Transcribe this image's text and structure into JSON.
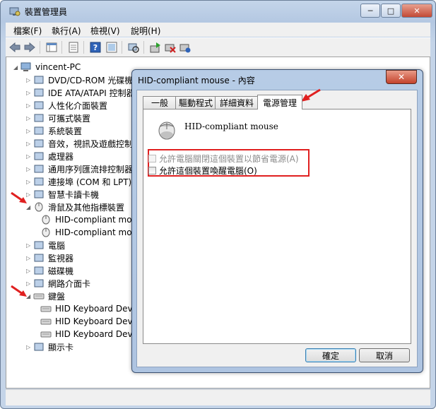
{
  "window": {
    "title": "裝置管理員",
    "controls": [
      "─",
      "□",
      "✕"
    ]
  },
  "menu": [
    "檔案(F)",
    "執行(A)",
    "檢視(V)",
    "說明(H)"
  ],
  "toolbar_icons": [
    "back-icon",
    "forward-icon",
    "properties-grid-icon",
    "document-icon",
    "help-icon",
    "show-hidden-icon",
    "scan-hardware-icon",
    "update-driver-icon",
    "disable-device-icon",
    "uninstall-device-icon"
  ],
  "tree": {
    "root": "vincent-PC",
    "items": [
      {
        "label": "DVD/CD-ROM 光碟機",
        "icon": "dvd-drive-icon"
      },
      {
        "label": "IDE ATA/ATAPI 控制器",
        "icon": "ide-controller-icon"
      },
      {
        "label": "人性化介面裝置",
        "icon": "hid-icon"
      },
      {
        "label": "可攜式裝置",
        "icon": "portable-device-icon"
      },
      {
        "label": "系統裝置",
        "icon": "system-device-icon"
      },
      {
        "label": "音效，視訊及遊戲控制器",
        "icon": "speaker-icon"
      },
      {
        "label": "處理器",
        "icon": "processor-icon"
      },
      {
        "label": "通用序列匯流排控制器",
        "icon": "usb-icon"
      },
      {
        "label": "連接埠 (COM 和 LPT)",
        "icon": "port-icon"
      },
      {
        "label": "智慧卡讀卡機",
        "icon": "smartcard-reader-icon"
      },
      {
        "label": "滑鼠及其他指標裝置",
        "icon": "mouse-icon",
        "expanded": true,
        "children": [
          "HID-compliant mouse",
          "HID-compliant mouse"
        ]
      },
      {
        "label": "電腦",
        "icon": "computer-icon"
      },
      {
        "label": "監視器",
        "icon": "monitor-icon"
      },
      {
        "label": "磁碟機",
        "icon": "disk-drive-icon"
      },
      {
        "label": "網路介面卡",
        "icon": "network-adapter-icon"
      },
      {
        "label": "鍵盤",
        "icon": "keyboard-icon",
        "expanded": true,
        "children": [
          "HID Keyboard Device",
          "HID Keyboard Device",
          "HID Keyboard Device"
        ]
      },
      {
        "label": "顯示卡",
        "icon": "display-adapter-icon"
      }
    ]
  },
  "dialog": {
    "title": "HID-compliant mouse - 內容",
    "close": "✕",
    "tabs": [
      "一般",
      "驅動程式",
      "詳細資料",
      "電源管理"
    ],
    "active_tab": 3,
    "device_name": "HID-compliant mouse",
    "options": [
      {
        "label": "允許電腦關閉這個裝置以節省電源(A)",
        "checked": false,
        "enabled": false
      },
      {
        "label": "允許這個裝置喚醒電腦(O)",
        "checked": false,
        "enabled": true
      }
    ],
    "ok": "確定",
    "cancel": "取消"
  },
  "colors": {
    "highlight": "#e02020",
    "frame": "#b9cde6"
  }
}
